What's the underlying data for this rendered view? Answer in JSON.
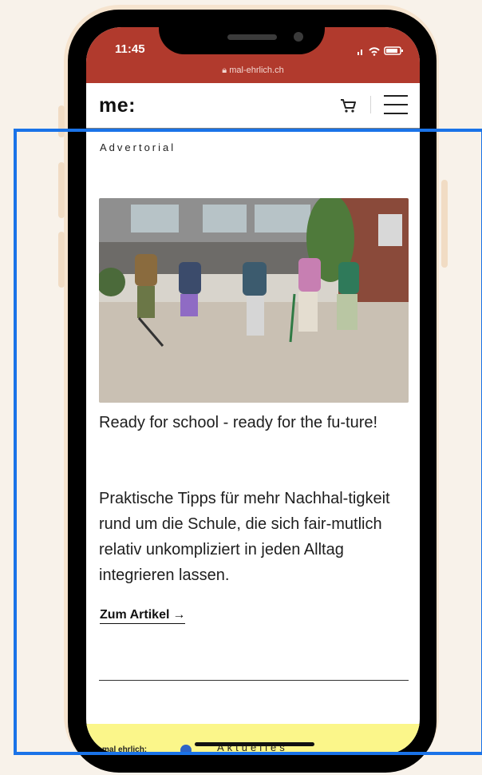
{
  "status": {
    "time": "11:45",
    "url": "mal-ehrlich.ch"
  },
  "header": {
    "logo": "me:"
  },
  "article": {
    "kicker": "Advertorial",
    "headline": "Ready for school - ready for the fu-ture!",
    "body": "Praktische Tipps für mehr Nachhal-tigkeit rund um die Schule, die sich fair-mutlich relativ unkompliziert in jeden Alltag integrieren lassen.",
    "cta": "Zum Artikel",
    "cta_arrow": "→"
  },
  "bottom_bar": {
    "brand": "mal ehrlich:",
    "tab": "Aktuelles"
  },
  "colors": {
    "accent": "#b13a2d",
    "highlight": "#1a73e8",
    "bottom_bar": "#fbf68a"
  }
}
